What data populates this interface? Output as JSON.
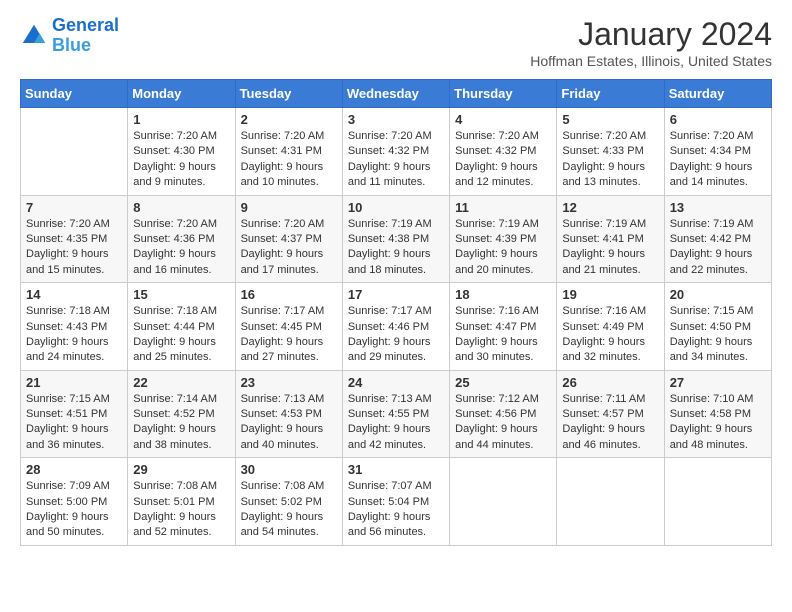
{
  "header": {
    "logo_line1": "General",
    "logo_line2": "Blue",
    "month_title": "January 2024",
    "location": "Hoffman Estates, Illinois, United States"
  },
  "weekdays": [
    "Sunday",
    "Monday",
    "Tuesday",
    "Wednesday",
    "Thursday",
    "Friday",
    "Saturday"
  ],
  "weeks": [
    [
      {
        "day": "",
        "sunrise": "",
        "sunset": "",
        "daylight": ""
      },
      {
        "day": "1",
        "sunrise": "Sunrise: 7:20 AM",
        "sunset": "Sunset: 4:30 PM",
        "daylight": "Daylight: 9 hours and 9 minutes."
      },
      {
        "day": "2",
        "sunrise": "Sunrise: 7:20 AM",
        "sunset": "Sunset: 4:31 PM",
        "daylight": "Daylight: 9 hours and 10 minutes."
      },
      {
        "day": "3",
        "sunrise": "Sunrise: 7:20 AM",
        "sunset": "Sunset: 4:32 PM",
        "daylight": "Daylight: 9 hours and 11 minutes."
      },
      {
        "day": "4",
        "sunrise": "Sunrise: 7:20 AM",
        "sunset": "Sunset: 4:32 PM",
        "daylight": "Daylight: 9 hours and 12 minutes."
      },
      {
        "day": "5",
        "sunrise": "Sunrise: 7:20 AM",
        "sunset": "Sunset: 4:33 PM",
        "daylight": "Daylight: 9 hours and 13 minutes."
      },
      {
        "day": "6",
        "sunrise": "Sunrise: 7:20 AM",
        "sunset": "Sunset: 4:34 PM",
        "daylight": "Daylight: 9 hours and 14 minutes."
      }
    ],
    [
      {
        "day": "7",
        "sunrise": "Sunrise: 7:20 AM",
        "sunset": "Sunset: 4:35 PM",
        "daylight": "Daylight: 9 hours and 15 minutes."
      },
      {
        "day": "8",
        "sunrise": "Sunrise: 7:20 AM",
        "sunset": "Sunset: 4:36 PM",
        "daylight": "Daylight: 9 hours and 16 minutes."
      },
      {
        "day": "9",
        "sunrise": "Sunrise: 7:20 AM",
        "sunset": "Sunset: 4:37 PM",
        "daylight": "Daylight: 9 hours and 17 minutes."
      },
      {
        "day": "10",
        "sunrise": "Sunrise: 7:19 AM",
        "sunset": "Sunset: 4:38 PM",
        "daylight": "Daylight: 9 hours and 18 minutes."
      },
      {
        "day": "11",
        "sunrise": "Sunrise: 7:19 AM",
        "sunset": "Sunset: 4:39 PM",
        "daylight": "Daylight: 9 hours and 20 minutes."
      },
      {
        "day": "12",
        "sunrise": "Sunrise: 7:19 AM",
        "sunset": "Sunset: 4:41 PM",
        "daylight": "Daylight: 9 hours and 21 minutes."
      },
      {
        "day": "13",
        "sunrise": "Sunrise: 7:19 AM",
        "sunset": "Sunset: 4:42 PM",
        "daylight": "Daylight: 9 hours and 22 minutes."
      }
    ],
    [
      {
        "day": "14",
        "sunrise": "Sunrise: 7:18 AM",
        "sunset": "Sunset: 4:43 PM",
        "daylight": "Daylight: 9 hours and 24 minutes."
      },
      {
        "day": "15",
        "sunrise": "Sunrise: 7:18 AM",
        "sunset": "Sunset: 4:44 PM",
        "daylight": "Daylight: 9 hours and 25 minutes."
      },
      {
        "day": "16",
        "sunrise": "Sunrise: 7:17 AM",
        "sunset": "Sunset: 4:45 PM",
        "daylight": "Daylight: 9 hours and 27 minutes."
      },
      {
        "day": "17",
        "sunrise": "Sunrise: 7:17 AM",
        "sunset": "Sunset: 4:46 PM",
        "daylight": "Daylight: 9 hours and 29 minutes."
      },
      {
        "day": "18",
        "sunrise": "Sunrise: 7:16 AM",
        "sunset": "Sunset: 4:47 PM",
        "daylight": "Daylight: 9 hours and 30 minutes."
      },
      {
        "day": "19",
        "sunrise": "Sunrise: 7:16 AM",
        "sunset": "Sunset: 4:49 PM",
        "daylight": "Daylight: 9 hours and 32 minutes."
      },
      {
        "day": "20",
        "sunrise": "Sunrise: 7:15 AM",
        "sunset": "Sunset: 4:50 PM",
        "daylight": "Daylight: 9 hours and 34 minutes."
      }
    ],
    [
      {
        "day": "21",
        "sunrise": "Sunrise: 7:15 AM",
        "sunset": "Sunset: 4:51 PM",
        "daylight": "Daylight: 9 hours and 36 minutes."
      },
      {
        "day": "22",
        "sunrise": "Sunrise: 7:14 AM",
        "sunset": "Sunset: 4:52 PM",
        "daylight": "Daylight: 9 hours and 38 minutes."
      },
      {
        "day": "23",
        "sunrise": "Sunrise: 7:13 AM",
        "sunset": "Sunset: 4:53 PM",
        "daylight": "Daylight: 9 hours and 40 minutes."
      },
      {
        "day": "24",
        "sunrise": "Sunrise: 7:13 AM",
        "sunset": "Sunset: 4:55 PM",
        "daylight": "Daylight: 9 hours and 42 minutes."
      },
      {
        "day": "25",
        "sunrise": "Sunrise: 7:12 AM",
        "sunset": "Sunset: 4:56 PM",
        "daylight": "Daylight: 9 hours and 44 minutes."
      },
      {
        "day": "26",
        "sunrise": "Sunrise: 7:11 AM",
        "sunset": "Sunset: 4:57 PM",
        "daylight": "Daylight: 9 hours and 46 minutes."
      },
      {
        "day": "27",
        "sunrise": "Sunrise: 7:10 AM",
        "sunset": "Sunset: 4:58 PM",
        "daylight": "Daylight: 9 hours and 48 minutes."
      }
    ],
    [
      {
        "day": "28",
        "sunrise": "Sunrise: 7:09 AM",
        "sunset": "Sunset: 5:00 PM",
        "daylight": "Daylight: 9 hours and 50 minutes."
      },
      {
        "day": "29",
        "sunrise": "Sunrise: 7:08 AM",
        "sunset": "Sunset: 5:01 PM",
        "daylight": "Daylight: 9 hours and 52 minutes."
      },
      {
        "day": "30",
        "sunrise": "Sunrise: 7:08 AM",
        "sunset": "Sunset: 5:02 PM",
        "daylight": "Daylight: 9 hours and 54 minutes."
      },
      {
        "day": "31",
        "sunrise": "Sunrise: 7:07 AM",
        "sunset": "Sunset: 5:04 PM",
        "daylight": "Daylight: 9 hours and 56 minutes."
      },
      {
        "day": "",
        "sunrise": "",
        "sunset": "",
        "daylight": ""
      },
      {
        "day": "",
        "sunrise": "",
        "sunset": "",
        "daylight": ""
      },
      {
        "day": "",
        "sunrise": "",
        "sunset": "",
        "daylight": ""
      }
    ]
  ]
}
